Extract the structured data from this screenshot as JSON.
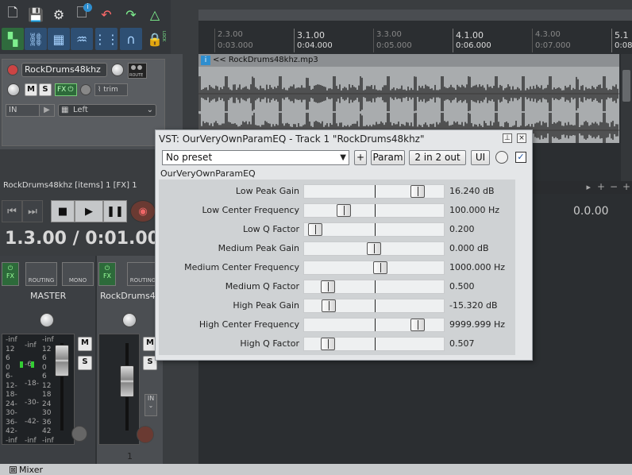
{
  "toolbar": {
    "icons": [
      "new-project-icon",
      "save-icon",
      "project-settings-icon",
      "info-icon",
      "undo-icon",
      "redo-icon",
      "metronome-icon",
      "snap-icon",
      "ripple-edit-icon",
      "grid-icon",
      "envelope-icon",
      "loop-icon",
      "magnet-icon",
      "lock-icon"
    ],
    "info_badge": "i",
    "lock_label": "LOCK"
  },
  "ruler": {
    "marks": [
      {
        "bar": "2.3.00",
        "time": "0:03.000"
      },
      {
        "bar": "3.1.00",
        "time": "0:04.000"
      },
      {
        "bar": "3.3.00",
        "time": "0:05.000"
      },
      {
        "bar": "4.1.00",
        "time": "0:06.000"
      },
      {
        "bar": "4.3.00",
        "time": "0:07.000"
      },
      {
        "bar": "5.1",
        "time": "0:08"
      }
    ]
  },
  "item": {
    "badge": "i",
    "name": "<< RockDrums48khz.mp3"
  },
  "track": {
    "name": "RockDrums48khz",
    "mute": "M",
    "solo": "S",
    "fx": "FX",
    "trim": "trim",
    "route": "ROUTE",
    "input": "IN",
    "input_channel": "Left",
    "number": "1"
  },
  "transport": {
    "label": "RockDrums48khz [items] 1 [FX] 1",
    "timecode": "1.3.00 / 0:01.000",
    "right_readout": "0.0.00",
    "icons": [
      "go-start-icon",
      "go-end-icon",
      "stop-icon",
      "play-icon",
      "pause-icon",
      "record-icon"
    ]
  },
  "mixer": {
    "master": {
      "name": "MASTER",
      "fx": "FX",
      "routing": "ROUTING",
      "mono": "MONO",
      "mute": "M",
      "solo": "S",
      "scale_left": [
        "-inf",
        "12",
        "6",
        "0",
        "6-",
        "12-",
        "18-",
        "24-",
        "30-",
        "36-",
        "42-",
        "-inf"
      ],
      "scale_mid": [
        "-inf",
        "-6-",
        "-18-",
        "-30-",
        "-42-",
        "-inf"
      ],
      "scale_right": [
        "-inf",
        "12",
        "6",
        "0",
        "6",
        "12",
        "18",
        "24",
        "30",
        "36",
        "42",
        "-inf"
      ]
    },
    "track": {
      "name": "RockDrums4",
      "fx": "FX",
      "routing": "ROUTING",
      "mute": "M",
      "solo": "S",
      "input": "IN",
      "number": "1"
    },
    "tab_label": "Mixer",
    "tab_close": "⊠"
  },
  "vst": {
    "title": "VST: OurVeryOwnParamEQ - Track 1 \"RockDrums48khz\"",
    "preset": "No preset",
    "plus": "+",
    "param": "Param",
    "io": "2 in 2 out",
    "ui": "UI",
    "bypass": "✓",
    "plugin_name": "OurVeryOwnParamEQ",
    "params": [
      {
        "name": "Low Peak Gain",
        "value": "16.240 dB",
        "pos": 0.85
      },
      {
        "name": "Low Center Frequency",
        "value": "100.000 Hz",
        "pos": 0.26
      },
      {
        "name": "Low Q Factor",
        "value": "0.200",
        "pos": 0.03
      },
      {
        "name": "Medium Peak Gain",
        "value": "0.000 dB",
        "pos": 0.5
      },
      {
        "name": "Medium Center Frequency",
        "value": "1000.000 Hz",
        "pos": 0.55
      },
      {
        "name": "Medium Q Factor",
        "value": "0.500",
        "pos": 0.13
      },
      {
        "name": "High Peak Gain",
        "value": "-15.320 dB",
        "pos": 0.14
      },
      {
        "name": "High Center Frequency",
        "value": "9999.999 Hz",
        "pos": 0.85
      },
      {
        "name": "High Q Factor",
        "value": "0.507",
        "pos": 0.13
      }
    ]
  }
}
